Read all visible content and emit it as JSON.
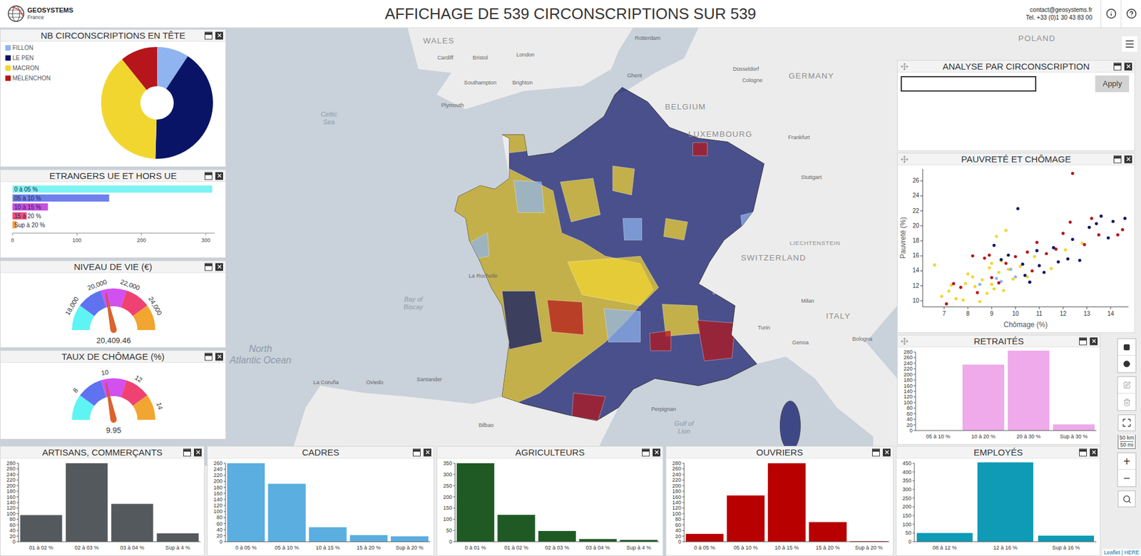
{
  "header": {
    "logo_name": "GEOSYSTEMS",
    "logo_subtitle": "France",
    "title": "AFFICHAGE DE 539 CIRCONSCRIPTIONS SUR 539",
    "email": "contact@geosystems.fr",
    "phone": "Tel. +33 (0)1 30 43 83 00"
  },
  "leaders": {
    "title": "NB CIRCONSCRIPTIONS EN TÊTE",
    "items": [
      {
        "label": "FILLON",
        "value": 50,
        "color": "#8fb4ef"
      },
      {
        "label": "LE PEN",
        "value": 222,
        "color": "#0a1466"
      },
      {
        "label": "MACRON",
        "value": 209,
        "color": "#f2d630"
      },
      {
        "label": "MÉLENCHON",
        "value": 58,
        "color": "#b5151b"
      }
    ]
  },
  "foreigners": {
    "title": "ETRANGERS UE ET HORS UE",
    "x_ticks": [
      "0",
      "100",
      "200",
      "300"
    ],
    "bars": [
      {
        "label": "0 à 05 %",
        "value": 310,
        "color": "#7df3f3"
      },
      {
        "label": "05 à 10 %",
        "value": 150,
        "color": "#6f80ee"
      },
      {
        "label": "10 à 15 %",
        "value": 55,
        "color": "#c64fe0"
      },
      {
        "label": "15 à 20 %",
        "value": 22,
        "color": "#f0507c"
      },
      {
        "label": "Sup à 20 %",
        "value": 6,
        "color": "#f2a23c"
      }
    ]
  },
  "living_standard": {
    "title": "NIVEAU DE VIE (€)",
    "ticks": [
      {
        "label": "18,000",
        "level": 0.167
      },
      {
        "label": "20,000",
        "level": 0.389
      },
      {
        "label": "22,000",
        "level": 0.611
      },
      {
        "label": "24,000",
        "level": 0.833
      }
    ],
    "level": 0.434,
    "reading": "20,409.46"
  },
  "unemployment": {
    "title": "TAUX DE CHÔMAGE (%)",
    "ticks": [
      {
        "label": "8",
        "level": 0.209
      },
      {
        "label": "10",
        "level": 0.442
      },
      {
        "label": "12",
        "level": 0.674
      },
      {
        "label": "14",
        "level": 0.907
      }
    ],
    "level": 0.436,
    "reading": "9.95"
  },
  "analysis": {
    "title": "ANALYSE PAR CIRCONSCRIPTION",
    "input_value": "",
    "button": "Apply"
  },
  "scatter": {
    "title": "PAUVRETÉ ET CHÔMAGE",
    "x_label": "Chômage (%)",
    "y_label": "Pauvreté (%)",
    "x_ticks": [
      "7",
      "8",
      "9",
      "10",
      "11",
      "12",
      "13",
      "14"
    ],
    "y_ticks": [
      "10",
      "12",
      "14",
      "16",
      "18",
      "20",
      "22",
      "24",
      "26"
    ],
    "series": [
      {
        "candidate": "MACRON",
        "points": [
          [
            6.6,
            14.8
          ],
          [
            6.9,
            10.6
          ],
          [
            7.2,
            11.3
          ],
          [
            7.5,
            10.3
          ],
          [
            7.3,
            12.1
          ],
          [
            7.8,
            10.1
          ],
          [
            7.9,
            12.3
          ],
          [
            8.0,
            13.6
          ],
          [
            8.2,
            13.2
          ],
          [
            8.3,
            11.9
          ],
          [
            8.5,
            9.9
          ],
          [
            8.6,
            12.8
          ],
          [
            8.8,
            11.0
          ],
          [
            8.9,
            14.4
          ],
          [
            9.0,
            12.2
          ],
          [
            9.1,
            11.6
          ],
          [
            9.2,
            18.6
          ],
          [
            9.3,
            13.8
          ],
          [
            9.4,
            15.3
          ],
          [
            9.5,
            11.4
          ],
          [
            9.7,
            14.2
          ],
          [
            9.9,
            12.9
          ],
          [
            10.2,
            14.6
          ],
          [
            10.5,
            13.2
          ],
          [
            10.8,
            15.9
          ],
          [
            11.5,
            14.3
          ],
          [
            12.1,
            16.8
          ],
          [
            12.8,
            17.7
          ],
          [
            9.6,
            19.4
          ],
          [
            9.0,
            15.0
          ]
        ]
      },
      {
        "candidate": "FILLON",
        "points": [
          [
            8.5,
            12.2
          ],
          [
            9.2,
            13.0
          ],
          [
            9.4,
            12.6
          ],
          [
            9.8,
            14.2
          ],
          [
            10.0,
            13.2
          ],
          [
            10.6,
            12.5
          ]
        ]
      },
      {
        "candidate": "MÉLENCHON",
        "points": [
          [
            7.1,
            9.6
          ],
          [
            7.4,
            12.3
          ],
          [
            7.7,
            11.8
          ],
          [
            8.2,
            16.0
          ],
          [
            8.4,
            11.1
          ],
          [
            8.7,
            15.7
          ],
          [
            9.0,
            13.1
          ],
          [
            9.3,
            12.4
          ],
          [
            9.6,
            15.0
          ],
          [
            10.0,
            15.9
          ],
          [
            10.5,
            16.5
          ],
          [
            10.9,
            17.8
          ],
          [
            11.3,
            16.3
          ],
          [
            11.7,
            16.9
          ],
          [
            12.0,
            19.0
          ],
          [
            12.3,
            20.5
          ],
          [
            12.4,
            27.0
          ],
          [
            12.9,
            17.5
          ],
          [
            13.2,
            21.0
          ],
          [
            13.5,
            18.8
          ],
          [
            14.3,
            18.8
          ],
          [
            14.5,
            19.5
          ],
          [
            8.9,
            16.1
          ],
          [
            10.7,
            14.0
          ]
        ]
      },
      {
        "candidate": "LE PEN",
        "points": [
          [
            9.1,
            17.4
          ],
          [
            9.4,
            15.5
          ],
          [
            9.7,
            16.1
          ],
          [
            10.1,
            22.3
          ],
          [
            10.3,
            14.9
          ],
          [
            10.6,
            12.5
          ],
          [
            10.9,
            16.7
          ],
          [
            11.2,
            13.8
          ],
          [
            11.6,
            17.1
          ],
          [
            11.8,
            15.2
          ],
          [
            12.2,
            15.6
          ],
          [
            12.4,
            18.2
          ],
          [
            12.7,
            15.4
          ],
          [
            13.1,
            19.8
          ],
          [
            13.4,
            20.3
          ],
          [
            13.6,
            21.3
          ],
          [
            13.9,
            18.4
          ],
          [
            14.1,
            20.6
          ],
          [
            14.6,
            21.0
          ],
          [
            10.4,
            13.4
          ],
          [
            11.0,
            14.7
          ]
        ]
      }
    ]
  },
  "retirees": {
    "title": "RETRAITÉS",
    "color": "#eeaaea",
    "categories": [
      "05 à 10 %",
      "10 à 20 %",
      "20 à 30 %",
      "Sup à 30 %"
    ],
    "values": [
      0,
      235,
      285,
      22
    ],
    "y_ticks": [
      "0",
      "20",
      "40",
      "60",
      "80",
      "100",
      "120",
      "140",
      "160",
      "180",
      "200",
      "220",
      "240",
      "260",
      "280"
    ]
  },
  "bottom_charts": [
    {
      "title": "ARTISANS, COMMERÇANTS",
      "color": "#54595d",
      "categories": [
        "01 à 02 %",
        "02 à 03 %",
        "03 à 04 %",
        "Sup à 4 %"
      ],
      "values": [
        95,
        280,
        135,
        30
      ],
      "y_ticks": [
        "0",
        "20",
        "40",
        "60",
        "80",
        "100",
        "120",
        "140",
        "160",
        "180",
        "200",
        "220",
        "240",
        "260",
        "280"
      ]
    },
    {
      "title": "CADRES",
      "color": "#5aaee0",
      "categories": [
        "0 à 05 %",
        "05 à 10 %",
        "10 à 15 %",
        "15 à 20 %",
        "Sup à 20 %"
      ],
      "values": [
        260,
        192,
        48,
        22,
        18
      ],
      "y_ticks": [
        "0",
        "20",
        "40",
        "60",
        "80",
        "100",
        "120",
        "140",
        "160",
        "180",
        "200",
        "220",
        "240",
        "260"
      ]
    },
    {
      "title": "AGRICULTEURS",
      "color": "#1f5a25",
      "categories": [
        "0 à 01 %",
        "01 à 02 %",
        "02 à 03 %",
        "03 à 04 %",
        "Sup à 4 %"
      ],
      "values": [
        350,
        120,
        48,
        12,
        8
      ],
      "y_ticks": [
        "0",
        "50",
        "100",
        "150",
        "200",
        "250",
        "300",
        "350"
      ]
    },
    {
      "title": "OUVRIERS",
      "color": "#b80000",
      "categories": [
        "0 à 05 %",
        "05 à 10 %",
        "10 à 15 %",
        "15 à 20 %",
        "Sup à 20 %"
      ],
      "values": [
        28,
        165,
        280,
        70,
        2
      ],
      "y_ticks": [
        "0",
        "20",
        "40",
        "60",
        "80",
        "100",
        "120",
        "140",
        "160",
        "180",
        "200",
        "220",
        "240",
        "260",
        "280"
      ]
    },
    {
      "title": "EMPLOYÉS",
      "color": "#0f9ab5",
      "categories": [
        "08 à 12 %",
        "12 à 16 %",
        "Sup à 16 %"
      ],
      "values": [
        50,
        455,
        35
      ],
      "y_ticks": [
        "0",
        "50",
        "100",
        "150",
        "200",
        "250",
        "300",
        "350",
        "400",
        "450"
      ]
    }
  ],
  "map": {
    "base_leader": "LE PEN",
    "regions": [
      {
        "leader": "MACRON"
      },
      {
        "leader": "MACRON"
      },
      {
        "leader": "MACRON"
      },
      {
        "leader": "MACRON"
      },
      {
        "leader": "MACRON"
      },
      {
        "leader": "MACRON"
      },
      {
        "leader": "MACRON"
      },
      {
        "leader": "MACRON"
      },
      {
        "leader": "LE PEN"
      },
      {
        "leader": "MÉLENCHON"
      },
      {
        "leader": "MÉLENCHON"
      },
      {
        "leader": "MÉLENCHON"
      },
      {
        "leader": "MÉLENCHON"
      },
      {
        "leader": "MÉLENCHON"
      },
      {
        "leader": "FILLON"
      },
      {
        "leader": "FILLON"
      },
      {
        "leader": "FILLON"
      },
      {
        "leader": "FILLON"
      },
      {
        "leader": "FILLON"
      },
      {
        "leader": "FILLON"
      },
      {
        "leader": "FILLON"
      }
    ],
    "labels": [
      "WALES",
      "Cardiff",
      "Bristol",
      "London",
      "Southampton",
      "Brighton",
      "Plymouth",
      "Celtic",
      "Sea",
      "Bay of",
      "Biscay",
      "North",
      "Atlantic Ocean",
      "Rotterdam",
      "Ghent",
      "BELGIUM",
      "LUXEMBOURG",
      "Düsseldorf",
      "Cologne",
      "GERMANY",
      "Frankfurt",
      "Stuttgart",
      "POLAND",
      "SWITZERLAND",
      "LIECHTENSTEIN",
      "Milan",
      "Turin",
      "Genoa",
      "Bologna",
      "ITALY",
      "Gulf of",
      "Lion",
      "Bilbao",
      "Santander",
      "Oviedo",
      "La Coruña",
      "La Rochelle",
      "Perpignan"
    ],
    "controls": {
      "zoom_in": "+",
      "zoom_out": "−",
      "scale_km": "50 km",
      "scale_mi": "50 mi",
      "attribution": "Leaflet | HERE"
    }
  }
}
